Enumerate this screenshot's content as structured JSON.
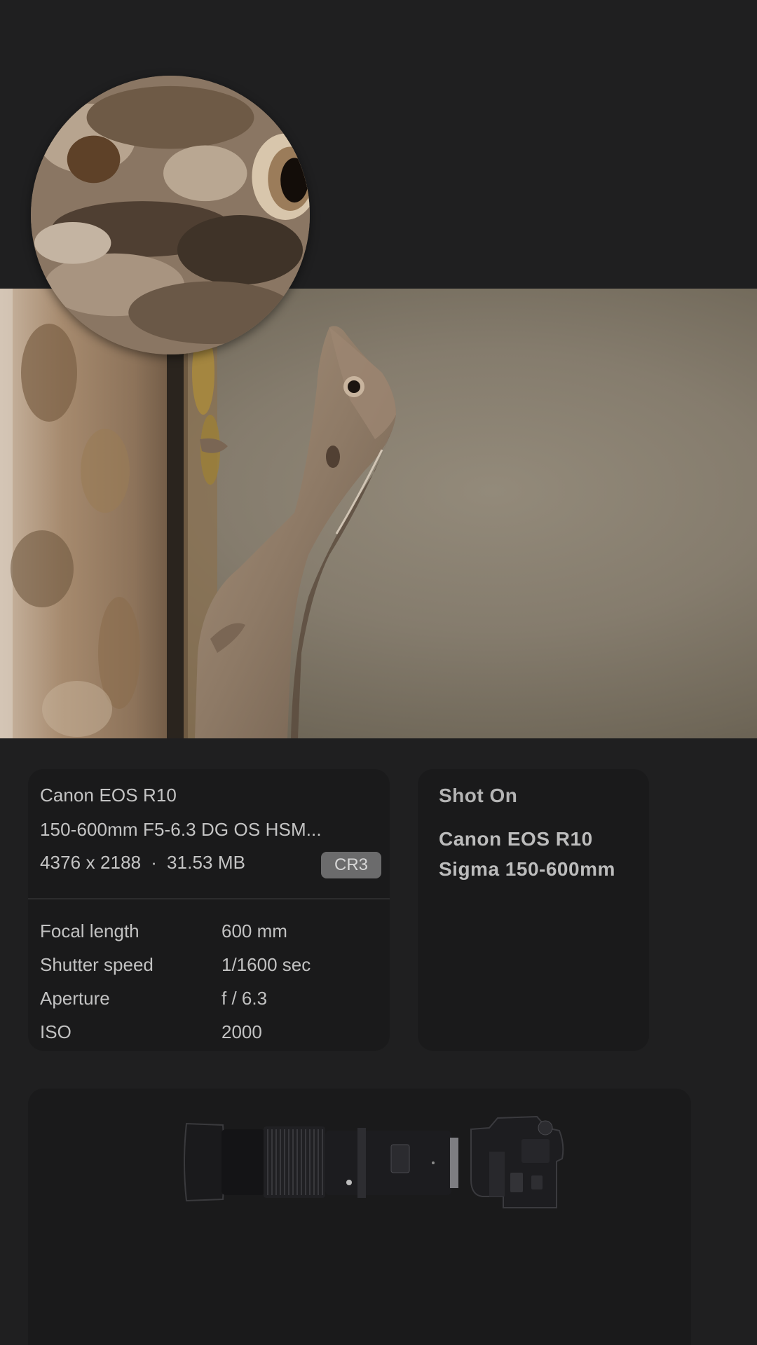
{
  "photo": {
    "subject": "lizard-on-tree-bark"
  },
  "loupe": {
    "subject": "zoomed-skin-texture"
  },
  "info": {
    "camera": "Canon EOS R10",
    "lens": "150-600mm F5-6.3 DG OS HSM...",
    "dimensions": "4376 x 2188",
    "separator": "·",
    "file_size": "31.53 MB",
    "format_badge": "CR3",
    "specs": [
      {
        "label": "Focal length",
        "value": "600 mm"
      },
      {
        "label": "Shutter speed",
        "value": "1/1600 sec"
      },
      {
        "label": "Aperture",
        "value": "f / 6.3"
      },
      {
        "label": "ISO",
        "value": "2000"
      }
    ]
  },
  "shot_on": {
    "title": "Shot On",
    "camera": "Canon EOS R10",
    "lens": "Sigma 150-600mm"
  },
  "colors": {
    "background": "#1f1f20",
    "card": "#1a1a1b",
    "badge": "#6b6b6c",
    "text": "#c4c4c4"
  }
}
